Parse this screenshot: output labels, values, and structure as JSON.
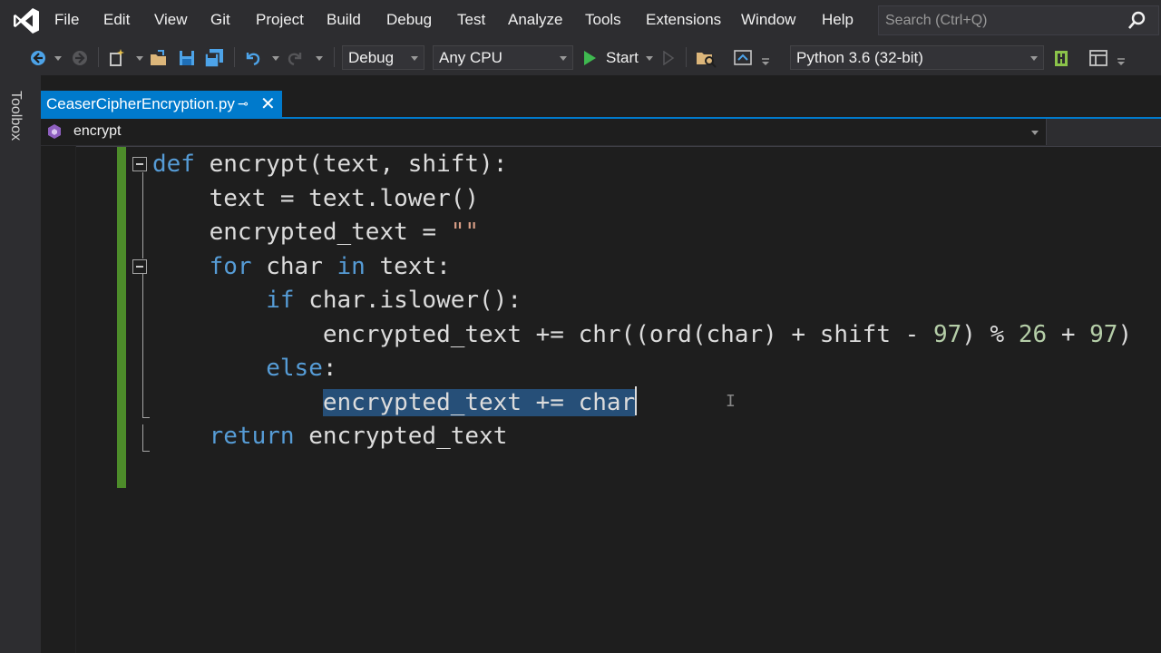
{
  "menu": {
    "items": [
      "File",
      "Edit",
      "View",
      "Git",
      "Project",
      "Build",
      "Debug",
      "Test",
      "Analyze",
      "Tools",
      "Extensions",
      "Window",
      "Help"
    ],
    "search_placeholder": "Search (Ctrl+Q)"
  },
  "toolbar": {
    "configuration": "Debug",
    "platform": "Any CPU",
    "start_label": "Start",
    "environment": "Python 3.6 (32-bit)"
  },
  "sidebar": {
    "toolbox_label": "Toolbox"
  },
  "editor": {
    "tab": {
      "filename": "CeaserCipherEncryption.py",
      "pin_glyph": "⊸",
      "close_glyph": "✕"
    },
    "navbar": {
      "scope": "encrypt"
    },
    "code_lines": [
      [
        {
          "t": "def",
          "c": "kw"
        },
        {
          "t": " encrypt(text, shift):"
        }
      ],
      [
        {
          "t": "    text = text.lower()"
        }
      ],
      [
        {
          "t": "    encrypted_text = "
        },
        {
          "t": "\"\"",
          "c": "str"
        }
      ],
      [
        {
          "t": "    "
        },
        {
          "t": "for",
          "c": "kw"
        },
        {
          "t": " char "
        },
        {
          "t": "in",
          "c": "kw"
        },
        {
          "t": " text:"
        }
      ],
      [
        {
          "t": "        "
        },
        {
          "t": "if",
          "c": "kw"
        },
        {
          "t": " char.islower():"
        }
      ],
      [
        {
          "t": "            encrypted_text += chr((ord(char) + shift - "
        },
        {
          "t": "97",
          "c": "num"
        },
        {
          "t": ") % "
        },
        {
          "t": "26",
          "c": "num"
        },
        {
          "t": " + "
        },
        {
          "t": "97",
          "c": "num"
        },
        {
          "t": ")"
        }
      ],
      [
        {
          "t": "        "
        },
        {
          "t": "else",
          "c": "kw"
        },
        {
          "t": ":"
        }
      ],
      [
        {
          "t": "            "
        },
        {
          "t": "encrypted_text += char",
          "c": "sel"
        },
        {
          "t": "",
          "c": "caret"
        }
      ],
      [
        {
          "t": "    "
        },
        {
          "t": "return",
          "c": "kw"
        },
        {
          "t": " encrypted_text"
        }
      ]
    ]
  },
  "colors": {
    "accent": "#007acc",
    "keyword": "#569cd6",
    "number": "#b5cea8",
    "string": "#d69d85",
    "selection": "#264f78",
    "change_bar": "#4d8c2a"
  }
}
